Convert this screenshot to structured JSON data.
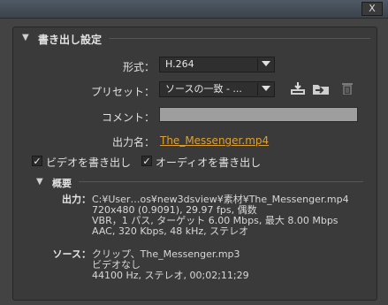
{
  "window": {
    "close_label": "X"
  },
  "export_settings": {
    "heading": "書き出し設定",
    "format": {
      "label": "形式：",
      "value": "H.264"
    },
    "preset": {
      "label": "プリセット：",
      "value": "ソースの一致 - ..."
    },
    "comment": {
      "label": "コメント：",
      "value": ""
    },
    "output_name": {
      "label": "出力名：",
      "value": "The_Messenger.mp4"
    },
    "export_video": {
      "label": "ビデオを書き出し",
      "checked": true
    },
    "export_audio": {
      "label": "オーディオを書き出し",
      "checked": true
    },
    "summary": {
      "heading": "概要",
      "output_label": "出力：",
      "output_lines": [
        "C:¥User…os¥new3dsview¥素材¥The_Messenger.mp4",
        "720x480 (0.9091), 29.97 fps, 偶数",
        "VBR，1 パス, ターゲット 6.00 Mbps, 最大 8.00 Mbps",
        "AAC, 320 Kbps, 48 kHz, ステレオ"
      ],
      "source_label": "ソース：",
      "source_lines": [
        "クリップ、The_Messenger.mp3",
        "ビデオなし",
        "44100 Hz, ステレオ, 00;02;11;29"
      ]
    }
  },
  "icons": [
    "save-preset-icon",
    "import-preset-icon",
    "delete-preset-icon"
  ]
}
